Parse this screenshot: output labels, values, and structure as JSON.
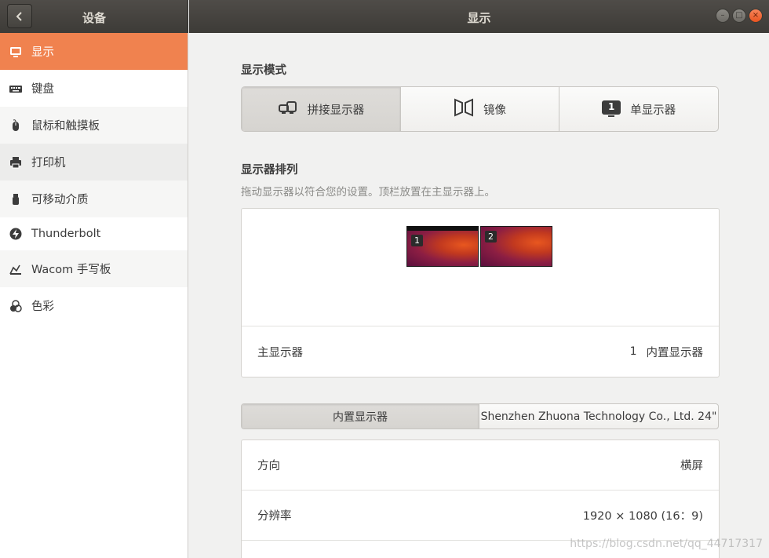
{
  "header": {
    "panel_title": "设备",
    "window_title": "显示"
  },
  "sidebar": {
    "items": [
      {
        "label": "显示",
        "icon": "display-icon"
      },
      {
        "label": "键盘",
        "icon": "keyboard-icon"
      },
      {
        "label": "鼠标和触摸板",
        "icon": "mouse-icon"
      },
      {
        "label": "打印机",
        "icon": "printer-icon"
      },
      {
        "label": "可移动介质",
        "icon": "usb-icon"
      },
      {
        "label": "Thunderbolt",
        "icon": "thunderbolt-icon"
      },
      {
        "label": "Wacom 手写板",
        "icon": "tablet-icon"
      },
      {
        "label": "色彩",
        "icon": "color-icon"
      }
    ]
  },
  "main": {
    "display_mode_title": "显示模式",
    "modes": [
      {
        "label": "拼接显示器",
        "icon": "join-displays-icon",
        "active": true
      },
      {
        "label": "镜像",
        "icon": "mirror-icon",
        "active": false
      },
      {
        "label": "单显示器",
        "icon": "single-display-icon",
        "badge": "1",
        "active": false
      }
    ],
    "arrangement_title": "显示器排列",
    "arrangement_hint": "拖动显示器以符合您的设置。顶栏放置在主显示器上。",
    "monitors": [
      {
        "number": "1"
      },
      {
        "number": "2"
      }
    ],
    "primary": {
      "label": "主显示器",
      "number": "1",
      "value": "内置显示器"
    },
    "display_tabs": [
      "内置显示器",
      "Shenzhen Zhuona Technology Co., Ltd. 24\""
    ],
    "settings": [
      {
        "label": "方向",
        "value": "横屏"
      },
      {
        "label": "分辨率",
        "value": "1920 × 1080 (16：9)"
      }
    ]
  },
  "watermark": "https://blog.csdn.net/qq_44717317",
  "colors": {
    "accent": "#f0824f",
    "titlebar": "#45433f",
    "close": "#e95420"
  }
}
